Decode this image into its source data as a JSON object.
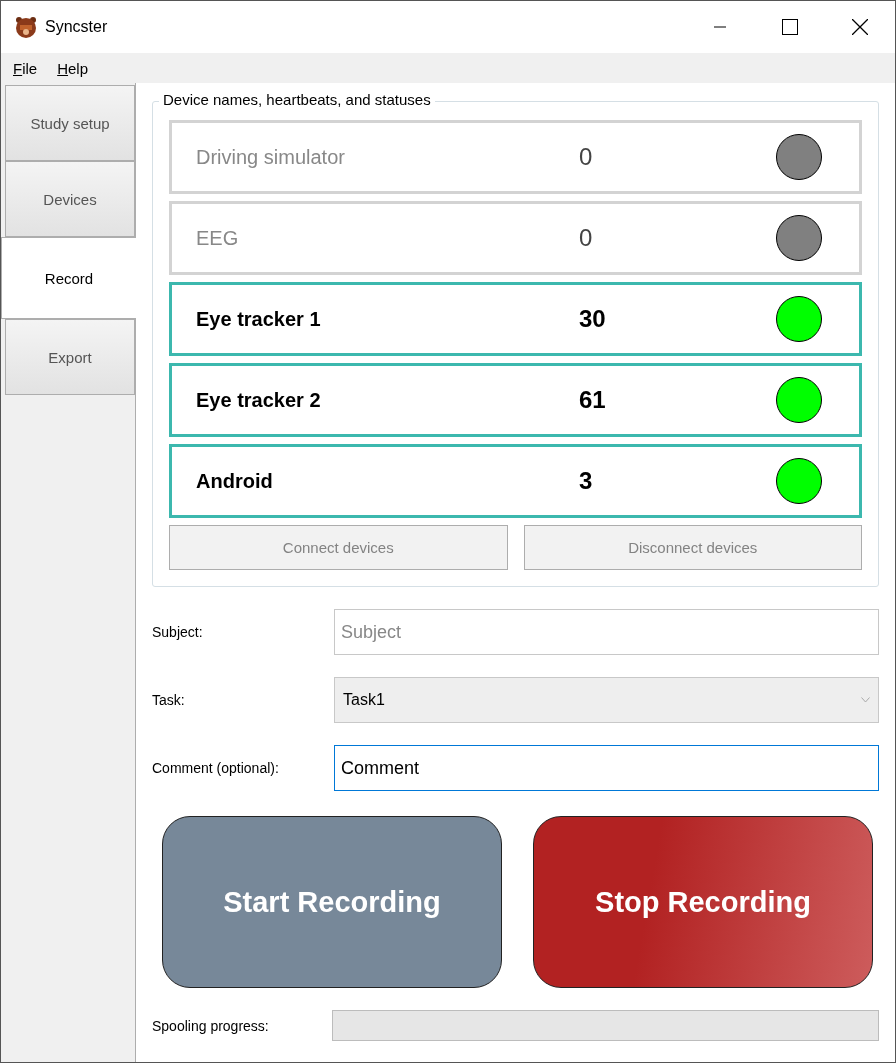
{
  "window": {
    "title": "Syncster"
  },
  "menu": [
    {
      "label": "File"
    },
    {
      "label": "Help"
    }
  ],
  "tabs": [
    {
      "label": "Study setup",
      "selected": false
    },
    {
      "label": "Devices",
      "selected": false
    },
    {
      "label": "Record",
      "selected": true
    },
    {
      "label": "Export",
      "selected": false
    }
  ],
  "device_group": {
    "title": "Device names, heartbeats, and statuses",
    "devices": [
      {
        "name": "Driving simulator",
        "heartbeat": "0",
        "connected": false,
        "color": "#808080"
      },
      {
        "name": "EEG",
        "heartbeat": "0",
        "connected": false,
        "color": "#808080"
      },
      {
        "name": "Eye tracker 1",
        "heartbeat": "30",
        "connected": true,
        "color": "#00ff00"
      },
      {
        "name": "Eye tracker 2",
        "heartbeat": "61",
        "connected": true,
        "color": "#00ff00"
      },
      {
        "name": "Android",
        "heartbeat": "3",
        "connected": true,
        "color": "#00ff00"
      }
    ],
    "buttons": [
      {
        "label": "Connect devices",
        "disabled": true
      },
      {
        "label": "Disconnect devices",
        "disabled": true
      }
    ]
  },
  "form": {
    "subject": {
      "label": "Subject:",
      "placeholder": "Subject"
    },
    "task": {
      "label": "Task:",
      "value": "Task1"
    },
    "comment": {
      "label": "Comment (optional):",
      "value": "Comment",
      "focused": true
    }
  },
  "actions": [
    {
      "label": "Start Recording",
      "kind": "start"
    },
    {
      "label": "Stop Recording",
      "kind": "stop"
    }
  ],
  "spooling": {
    "label": "Spooling progress:",
    "level": 0
  }
}
